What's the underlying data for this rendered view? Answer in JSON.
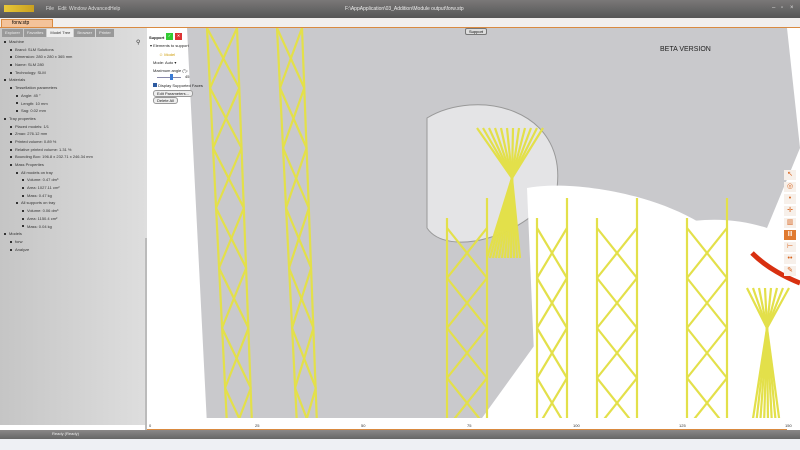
{
  "app": {
    "logo": "4D PRINTING",
    "menus": [
      "File",
      "Edit",
      "Window",
      "Advanced",
      "Help"
    ],
    "window_title": "F:\\AppApplication\\03_Addition\\Module output\\forw.stp",
    "doc_tab": "forw.stp"
  },
  "panel": {
    "tabs": [
      "Explorer",
      "Favorites",
      "Model Tree",
      "Browser",
      "Printer"
    ],
    "active_tab": "Model Tree",
    "tree": [
      {
        "level": 0,
        "text": "Machine"
      },
      {
        "level": 1,
        "text": "Brand: SLM Solutions"
      },
      {
        "level": 1,
        "text": "Dimension: 280 x 280 x 365 mm"
      },
      {
        "level": 1,
        "text": "Name: SLM 280"
      },
      {
        "level": 1,
        "text": "Technology: SLM"
      },
      {
        "level": 0,
        "text": "Materials"
      },
      {
        "level": 1,
        "text": "Tessellation parameters"
      },
      {
        "level": 2,
        "text": "Angle: 45 °"
      },
      {
        "level": 2,
        "text": "Length: 10 mm"
      },
      {
        "level": 2,
        "text": "Sag: 0.02 mm"
      },
      {
        "level": 0,
        "text": "Tray properties"
      },
      {
        "level": 1,
        "text": "Placed models: 1/1"
      },
      {
        "level": 1,
        "text": "Zmax: 276.12 mm"
      },
      {
        "level": 1,
        "text": "Printed volume: 0.89 %"
      },
      {
        "level": 1,
        "text": "Relative printed volume: 1.31 %"
      },
      {
        "level": 1,
        "text": "Bounding Box: 196.8 x 232.71 x 246.34 mm"
      },
      {
        "level": 1,
        "text": "Mass Properties"
      },
      {
        "level": 2,
        "text": "All models on tray"
      },
      {
        "level": 3,
        "text": "Volume: 0.47 dm³"
      },
      {
        "level": 3,
        "text": "Area: 1027.11 cm²"
      },
      {
        "level": 3,
        "text": "Mass: 0.47 kg"
      },
      {
        "level": 2,
        "text": "All supports on tray"
      },
      {
        "level": 3,
        "text": "Volume: 0.06 dm³"
      },
      {
        "level": 3,
        "text": "Area: 1150.4 cm²"
      },
      {
        "level": 3,
        "text": "Mass: 0.04 kg"
      },
      {
        "level": 0,
        "text": "Models"
      },
      {
        "level": 1,
        "text": "forw"
      },
      {
        "level": 1,
        "text": "Analyze"
      }
    ]
  },
  "support": {
    "title": "Support",
    "elements_label": "Elements to support",
    "model_label": "Model",
    "mode_label": "Mode:",
    "mode_value": "Auto",
    "max_angle_label": "Maximum angle (°):",
    "max_angle_value": "45",
    "display_faces_label": "Display Supported Faces",
    "display_faces_checked": true,
    "edit_params": "Edit Parameters...",
    "delete_all": "Delete All"
  },
  "viewport": {
    "beta": "BETA VERSION",
    "tag": "Support",
    "ruler_labels": [
      "0",
      "25",
      "50",
      "75",
      "100",
      "125",
      "150"
    ]
  },
  "status": {
    "text": "Ready (Ready)"
  },
  "colors": {
    "accent": "#d98a40",
    "support": "#e3e04a"
  }
}
